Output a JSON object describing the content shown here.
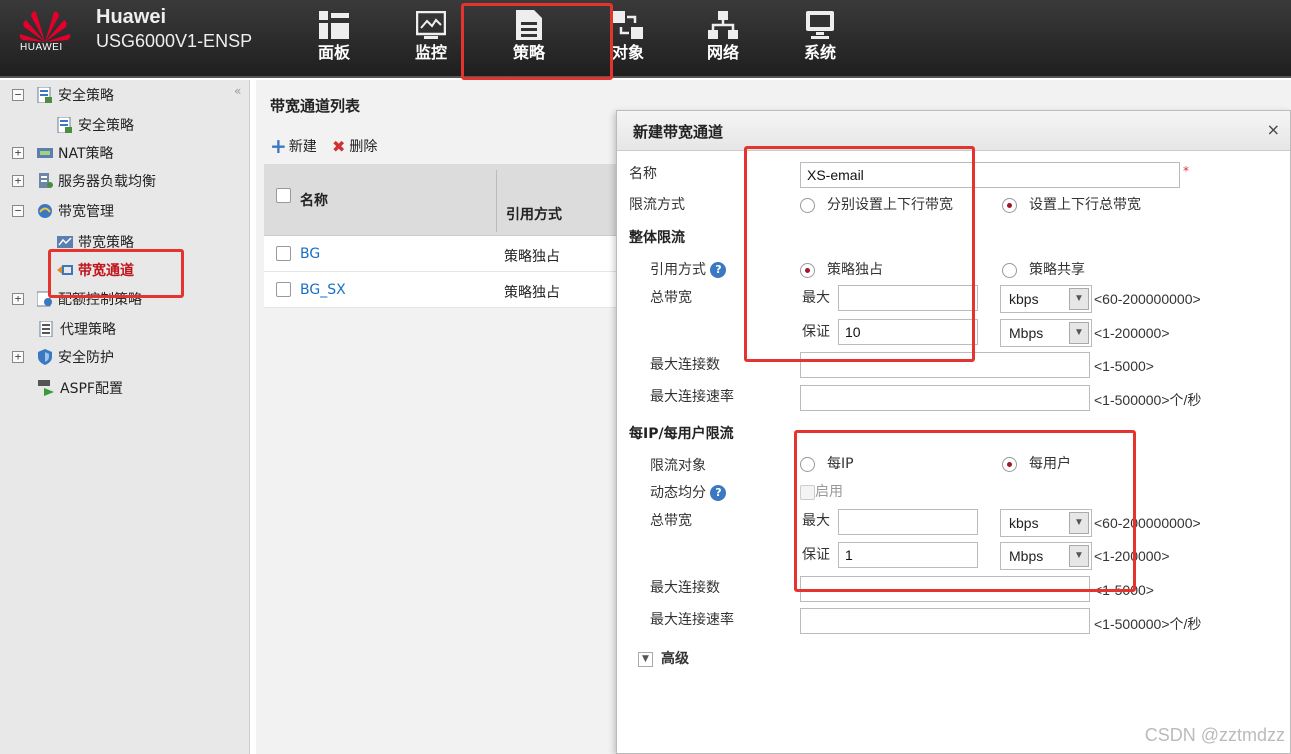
{
  "brand": {
    "line1": "Huawei",
    "line2": "USG6000V1-ENSP",
    "logo_text": "HUAWEI"
  },
  "nav": [
    {
      "label": "面板",
      "icon": "dashboard-icon"
    },
    {
      "label": "监控",
      "icon": "monitor-icon"
    },
    {
      "label": "策略",
      "icon": "policy-icon"
    },
    {
      "label": "对象",
      "icon": "object-icon"
    },
    {
      "label": "网络",
      "icon": "network-icon"
    },
    {
      "label": "系统",
      "icon": "system-icon"
    }
  ],
  "sidebar": {
    "items": [
      {
        "label": "安全策略",
        "icon": "security-policy-icon",
        "expander": "−"
      },
      {
        "label": "安全策略",
        "icon": "security-policy-icon"
      },
      {
        "label": "NAT策略",
        "icon": "nat-icon",
        "expander": "+"
      },
      {
        "label": "服务器负载均衡",
        "icon": "server-lb-icon",
        "expander": "+"
      },
      {
        "label": "带宽管理",
        "icon": "bandwidth-icon",
        "expander": "−"
      },
      {
        "label": "带宽策略",
        "icon": "bandwidth-policy-icon"
      },
      {
        "label": "带宽通道",
        "icon": "bandwidth-channel-icon"
      },
      {
        "label": "配额控制策略",
        "icon": "quota-icon",
        "expander": "+"
      },
      {
        "label": "代理策略",
        "icon": "proxy-icon"
      },
      {
        "label": "安全防护",
        "icon": "shield-icon",
        "expander": "+"
      },
      {
        "label": "ASPF配置",
        "icon": "aspf-icon"
      }
    ]
  },
  "list": {
    "title": "带宽通道列表",
    "new_label": "新建",
    "delete_label": "删除",
    "col_name": "名称",
    "col_mode": "引用方式",
    "rows": [
      {
        "name": "BG",
        "mode": "策略独占"
      },
      {
        "name": "BG_SX",
        "mode": "策略独占"
      }
    ]
  },
  "dialog": {
    "title": "新建带宽通道",
    "close": "×",
    "name_label": "名称",
    "name_value": "XS-email",
    "required_mark": "*",
    "limit_mode_label": "限流方式",
    "limit_mode_opt1": "分别设置上下行带宽",
    "limit_mode_opt2": "设置上下行总带宽",
    "overall": {
      "section": "整体限流",
      "ref_label": "引用方式",
      "ref_opt1": "策略独占",
      "ref_opt2": "策略共享",
      "total_bw_label": "总带宽",
      "max_label": "最大",
      "max_value": "",
      "max_unit": "kbps",
      "max_hint": "<60-200000000>",
      "guarantee_label": "保证",
      "guarantee_value": "10",
      "guarantee_unit": "Mbps",
      "guarantee_hint": "<1-200000>",
      "max_conn_label": "最大连接数",
      "max_conn_hint": "<1-5000>",
      "max_rate_label": "最大连接速率",
      "max_rate_hint": "<1-500000>个/秒"
    },
    "per_user": {
      "section": "每IP/每用户限流",
      "target_label": "限流对象",
      "target_opt1": "每IP",
      "target_opt2": "每用户",
      "dynamic_label": "动态均分",
      "dynamic_enable": "启用",
      "total_bw_label": "总带宽",
      "max_label": "最大",
      "max_value": "",
      "max_unit": "kbps",
      "max_hint": "<60-200000000>",
      "guarantee_label": "保证",
      "guarantee_value": "1",
      "guarantee_unit": "Mbps",
      "guarantee_hint": "<1-200000>",
      "max_conn_label": "最大连接数",
      "max_conn_hint": "<1-5000>",
      "max_rate_label": "最大连接速率",
      "max_rate_hint": "<1-500000>个/秒"
    },
    "advanced_label": "高级",
    "help_glyph": "?"
  },
  "watermark": "CSDN @zztmdzz",
  "colors": {
    "accent_red": "#e5332e",
    "link_blue": "#1a6fc4",
    "radio_selected": "#a01828"
  }
}
